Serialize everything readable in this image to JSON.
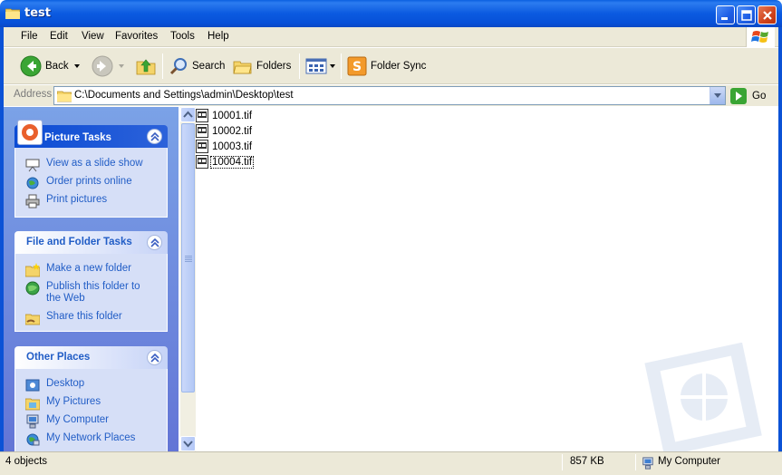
{
  "window": {
    "title": "test"
  },
  "menu": [
    "File",
    "Edit",
    "View",
    "Favorites",
    "Tools",
    "Help"
  ],
  "toolbar": {
    "back_label": "Back",
    "search_label": "Search",
    "folders_label": "Folders",
    "foldersync_label": "Folder Sync"
  },
  "address": {
    "label": "Address",
    "path": "C:\\Documents and Settings\\admin\\Desktop\\test",
    "go_label": "Go"
  },
  "taskpane": {
    "picture_tasks": {
      "title": "Picture Tasks",
      "items": [
        "View as a slide show",
        "Order prints online",
        "Print pictures"
      ]
    },
    "file_folder_tasks": {
      "title": "File and Folder Tasks",
      "items": [
        "Make a new folder",
        "Publish this folder to the Web",
        "Share this folder"
      ]
    },
    "other_places": {
      "title": "Other Places",
      "items": [
        "Desktop",
        "My Pictures",
        "My Computer",
        "My Network Places"
      ]
    }
  },
  "files": [
    {
      "name": "10001.tif",
      "selected": false
    },
    {
      "name": "10002.tif",
      "selected": false
    },
    {
      "name": "10003.tif",
      "selected": false
    },
    {
      "name": "10004.tif",
      "selected": true
    }
  ],
  "status": {
    "objects": "4 objects",
    "size": "857 KB",
    "location": "My Computer"
  },
  "colors": {
    "title_blue": "#0b5ae0",
    "link_blue": "#215dc6",
    "chrome": "#ece9d8"
  }
}
